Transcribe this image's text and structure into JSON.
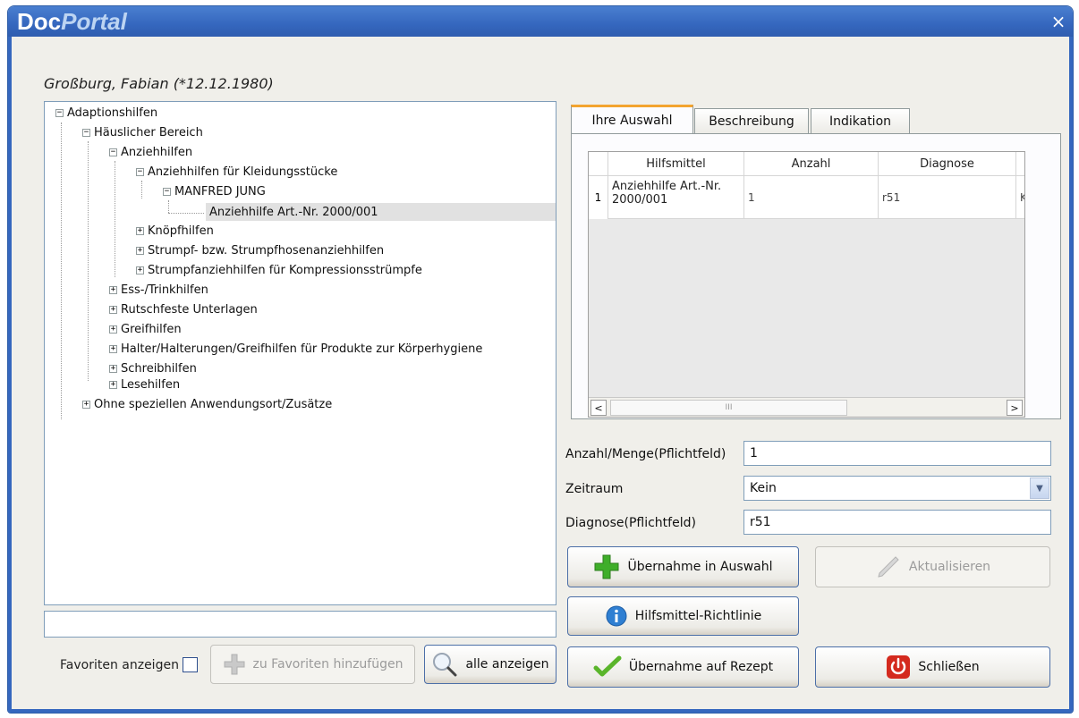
{
  "window": {
    "title_prefix": "Doc",
    "title_suffix": "Portal",
    "close_glyph": "×"
  },
  "patient": "Großburg, Fabian (*12.12.1980)",
  "tree": {
    "n1": "Adaptionshilfen",
    "n2": "Häuslicher Bereich",
    "n3": "Anziehhilfen",
    "n4": "Anziehhilfen für Kleidungsstücke",
    "n5": "MANFRED JUNG",
    "n6": "Anziehhilfe Art.-Nr. 2000/001",
    "n7": "Knöpfhilfen",
    "n8": "Strumpf- bzw. Strumpfhosenanziehhilfen",
    "n9": "Strumpfanziehhilfen für Kompressionsstrümpfe",
    "n10": "Ess-/Trinkhilfen",
    "n11": "Rutschfeste Unterlagen",
    "n12": "Greifhilfen",
    "n13": "Halter/Halterungen/Greifhilfen für Produkte zur Körperhygiene",
    "n14": "Schreibhilfen",
    "n15": "Lesehilfen",
    "n16": "Ohne speziellen Anwendungsort/Zusätze",
    "expanded_glyph": "−",
    "collapsed_glyph": "+"
  },
  "search": {
    "value": ""
  },
  "favorites": {
    "label": "Favoriten anzeigen",
    "add_label": "zu Favoriten hinzufügen",
    "show_all_label": "alle anzeigen"
  },
  "tabs": {
    "t1": "Ihre Auswahl",
    "t2": "Beschreibung",
    "t3": "Indikation"
  },
  "grid": {
    "col_hilfsmittel": "Hilfsmittel",
    "col_anzahl": "Anzahl",
    "col_diagnose": "Diagnose",
    "row1": {
      "num": "1",
      "hilfsmittel": "Anziehhilfe Art.-Nr. 2000/001",
      "anzahl": "1",
      "diagnose": "r51",
      "extra": "Ke"
    },
    "scroll_left": "<",
    "scroll_right": ">",
    "thumb_grip": "III"
  },
  "form": {
    "anzahl_label": "Anzahl/Menge(Pflichtfeld)",
    "anzahl_value": "1",
    "zeitraum_label": "Zeitraum",
    "zeitraum_value": "Kein",
    "diagnose_label": "Diagnose(Pflichtfeld)",
    "diagnose_value": "r51"
  },
  "buttons": {
    "uebernahme_auswahl": "Übernahme in Auswahl",
    "aktualisieren": "Aktualisieren",
    "richtlinie": "Hilfsmittel-Richtlinie",
    "uebernahme_rezept": "Übernahme auf Rezept",
    "schliessen": "Schließen"
  },
  "colors": {
    "title_bar": "#3567be",
    "tab_accent": "#f3a42f",
    "close_red": "#d42a1e",
    "plus_green": "#3fae2a",
    "info_blue": "#2f7fd2"
  }
}
